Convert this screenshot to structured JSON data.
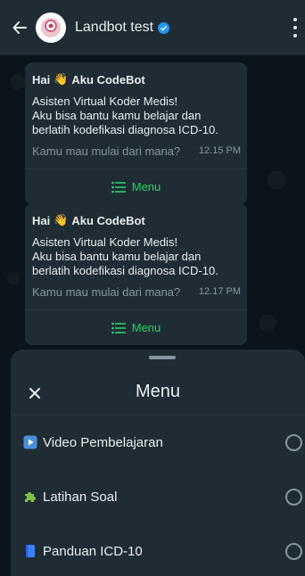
{
  "header": {
    "back_icon": "arrow-left-icon",
    "title": "Landbot test",
    "verified_icon": "verified-badge-icon",
    "more_icon": "more-vertical-icon"
  },
  "messages": [
    {
      "greeting": "Hai",
      "wave_icon": "waving-hand-icon",
      "sender": "Aku CodeBot",
      "lines": [
        "Asisten Virtual Koder Medis!",
        "Aku bisa bantu kamu belajar dan",
        "berlatih kodefikasi diagnosa ICD-10."
      ],
      "footer": "Kamu mau mulai dari mana?",
      "time": "12.15 PM",
      "button_label": "Menu"
    },
    {
      "greeting": "Hai",
      "wave_icon": "waving-hand-icon",
      "sender": "Aku CodeBot",
      "lines": [
        "Asisten Virtual Koder Medis!",
        "Aku bisa bantu kamu belajar dan",
        "berlatih kodefikasi diagnosa ICD-10."
      ],
      "footer": "Kamu mau mulai dari mana?",
      "time": "12.17 PM",
      "button_label": "Menu"
    }
  ],
  "sheet": {
    "title": "Menu",
    "close_icon": "close-icon",
    "options": [
      {
        "label": "Video Pembelajaran",
        "icon": "play-button-icon",
        "selected": false
      },
      {
        "label": "Latihan Soal",
        "icon": "puzzle-piece-icon",
        "selected": false
      },
      {
        "label": "Panduan ICD-10",
        "icon": "book-icon",
        "selected": false
      }
    ]
  },
  "colors": {
    "background": "#0b141a",
    "surface": "#1f2c34",
    "accent_green": "#25d366",
    "muted_text": "#8696a0",
    "verified_blue": "#2196f3"
  }
}
